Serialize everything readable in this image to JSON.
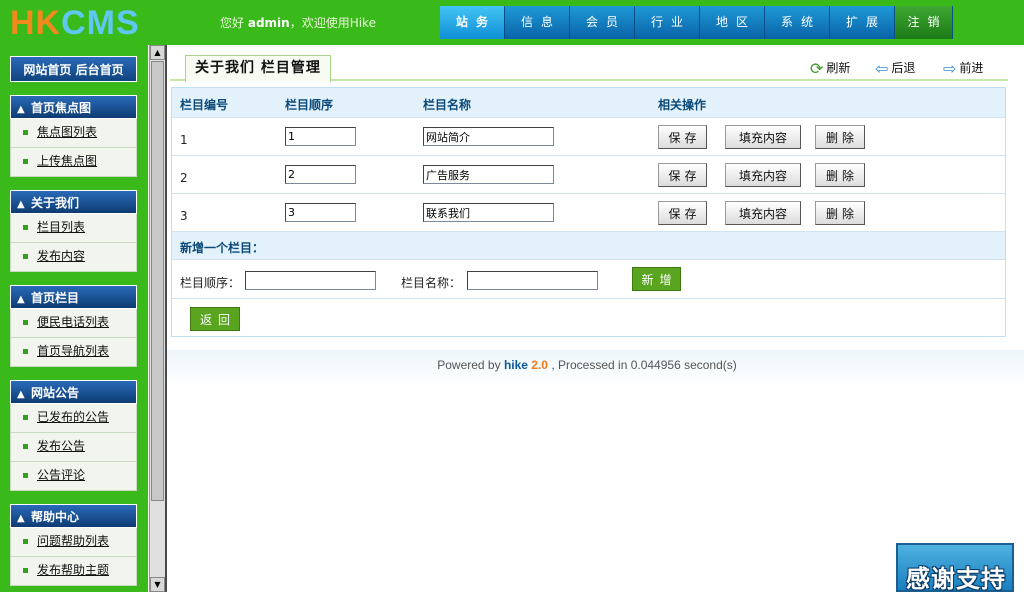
{
  "logo": {
    "part1": "HK",
    "part2": "CMS"
  },
  "welcome": {
    "prefix": "您好",
    "user": "admin",
    "suffix": "，欢迎使用Hike"
  },
  "topnav": [
    {
      "label": "站务",
      "icon": ""
    },
    {
      "label": "信息",
      "icon": ""
    },
    {
      "label": "会员",
      "icon": ""
    },
    {
      "label": "行业",
      "icon": ""
    },
    {
      "label": "地区",
      "icon": ""
    },
    {
      "label": "系统",
      "icon": ""
    },
    {
      "label": "扩展",
      "icon": ""
    },
    {
      "label": "注销",
      "icon": ""
    }
  ],
  "sidebar": {
    "quick_home": "网站首页",
    "quick_admin": "后台首页",
    "groups": [
      {
        "title": "首页焦点图",
        "items": [
          "焦点图列表",
          "上传焦点图"
        ]
      },
      {
        "title": "关于我们",
        "items": [
          "栏目列表",
          "发布内容"
        ]
      },
      {
        "title": "首页栏目",
        "items": [
          "便民电话列表",
          "首页导航列表"
        ]
      },
      {
        "title": "网站公告",
        "items": [
          "已发布的公告",
          "发布公告",
          "公告评论"
        ]
      },
      {
        "title": "帮助中心",
        "items": [
          "问题帮助列表",
          "发布帮助主题"
        ]
      }
    ]
  },
  "main": {
    "title": "关于我们  栏目管理",
    "toolbar": {
      "refresh": "刷新",
      "back": "后退",
      "forward": "前进"
    },
    "table": {
      "headers": {
        "id": "栏目编号",
        "order": "栏目顺序",
        "name": "栏目名称",
        "actions": "相关操作"
      },
      "rows": [
        {
          "id": "1",
          "order": "1",
          "name": "网站简介"
        },
        {
          "id": "2",
          "order": "2",
          "name": "广告服务"
        },
        {
          "id": "3",
          "order": "3",
          "name": "联系我们"
        }
      ],
      "buttons": {
        "save": "保存",
        "fill": "填充内容",
        "delete": "删除"
      }
    },
    "add": {
      "heading": "新增一个栏目：",
      "order_label": "栏目顺序：",
      "name_label": "栏目名称：",
      "order_value": "",
      "name_value": "",
      "add_button": "新增"
    },
    "return_button": "返回"
  },
  "footer": {
    "prefix": "Powered by",
    "brand": "hike",
    "version": "2.0",
    "suffix": ", Processed in 0.044956 second(s)"
  },
  "thanks": "感谢支持",
  "colors": {
    "green": "#39b91a",
    "blue": "#0a62a8",
    "accent": "#5aa51f"
  }
}
